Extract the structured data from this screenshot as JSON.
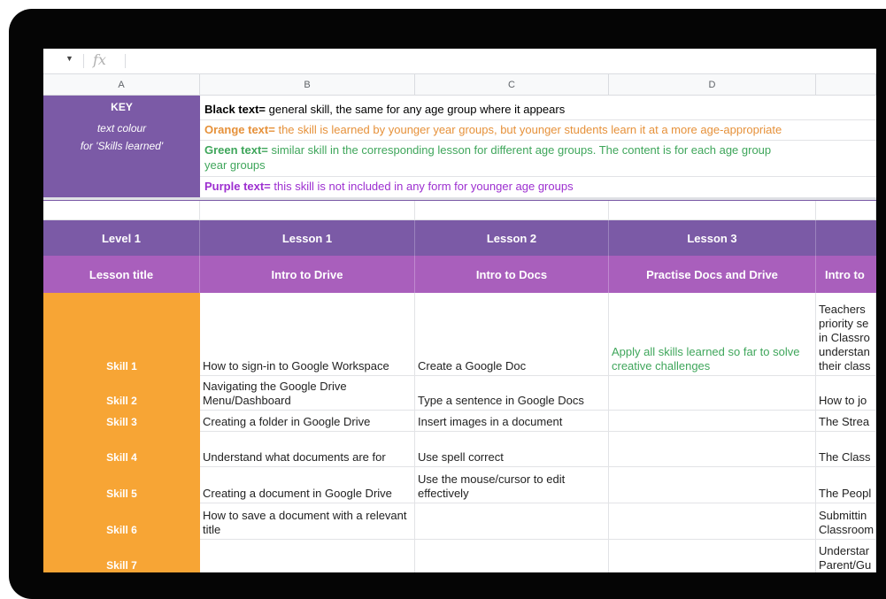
{
  "formula_bar": {
    "dropdown_icon": "caret-down-icon",
    "fx_label": "fx"
  },
  "columns": [
    "A",
    "B",
    "C",
    "D"
  ],
  "key": {
    "title": "KEY",
    "subtitle_line1": "text colour",
    "subtitle_line2": "for 'Skills learned'",
    "black_label": "Black text=",
    "black_desc": " general skill, the same for any age group where it appears",
    "orange_label": "Orange text=",
    "orange_desc": " the skill is learned by younger year groups, but younger students learn it at a more age-appropriate",
    "green_label": "Green text=",
    "green_desc": " similar skill in the corresponding lesson for different age groups.  The content is for each age group",
    "green_desc_line2": "year groups",
    "purple_label": "Purple text=",
    "purple_desc": " this skill is not included in any form for younger age groups",
    "colors": {
      "black": "#000000",
      "orange": "#e6913a",
      "green": "#3fa65b",
      "purple": "#9d2fd0"
    }
  },
  "header": {
    "level": "Level 1",
    "lessons": [
      "Lesson 1",
      "Lesson 2",
      "Lesson 3"
    ],
    "title_label": "Lesson title",
    "titles": [
      "Intro to Drive",
      "Intro to Docs",
      "Practise Docs and Drive",
      "Intro to"
    ]
  },
  "rows": [
    {
      "skill": "Skill 1",
      "b": "How to sign-in to Google Workspace",
      "c": "Create a Google Doc",
      "d": "Apply all skills learned so far to solve creative challenges",
      "e": "Teachers priority se in Classro understan their class"
    },
    {
      "skill": "Skill 2",
      "b": "Navigating the Google Drive Menu/Dashboard",
      "c": "Type a sentence in Google Docs",
      "d": "",
      "e": "How to jo"
    },
    {
      "skill": "Skill 3",
      "b": "Creating a folder in Google Drive",
      "c": "Insert images in a document",
      "d": "",
      "e": "The Strea"
    },
    {
      "skill": "Skill 4",
      "b": "Understand what documents are for",
      "c": "Use spell correct",
      "d": "",
      "e": "The Class"
    },
    {
      "skill": "Skill 5",
      "b": "Creating a document in Google Drive",
      "c": "Use the mouse/cursor to edit effectively",
      "d": "",
      "e": "The Peopl"
    },
    {
      "skill": "Skill 6",
      "b": "How to save a document with a relevant title",
      "c": "",
      "d": "",
      "e": "Submittin Classroom"
    },
    {
      "skill": "Skill 7",
      "b": "",
      "c": "",
      "d": "",
      "e": "Understar Parent/Gu"
    }
  ],
  "theme": {
    "purple_dark": "#7b5aa6",
    "purple_light": "#a95fbc",
    "orange": "#f7a535"
  }
}
